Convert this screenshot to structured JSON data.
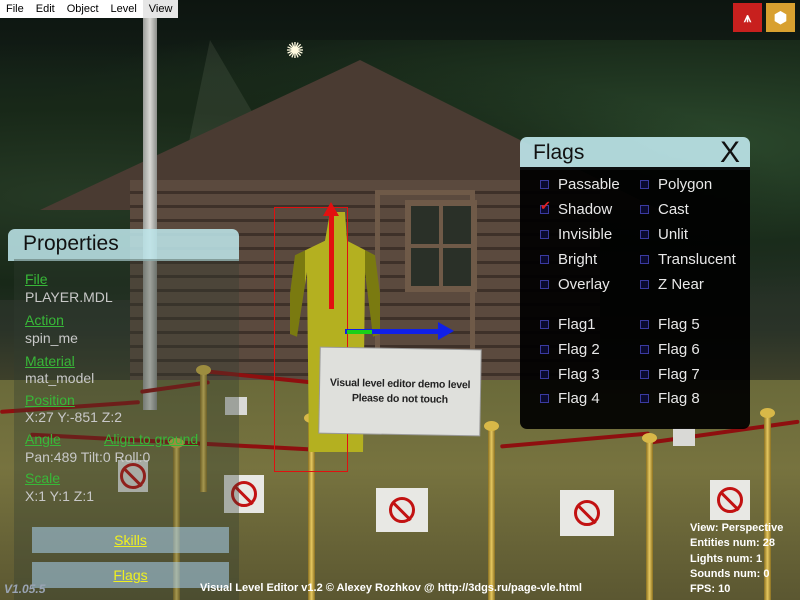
{
  "menu": {
    "items": [
      "File",
      "Edit",
      "Object",
      "Level",
      "View"
    ],
    "active": "View"
  },
  "toolbar": {
    "icons": [
      "atari-icon",
      "package-icon"
    ]
  },
  "scene": {
    "sign_lines": [
      "Visual level editor demo level",
      "Please do not touch"
    ]
  },
  "properties": {
    "title": "Properties",
    "file_label": "File",
    "file_value": "PLAYER.MDL",
    "action_label": "Action",
    "action_value": "spin_me",
    "material_label": "Material",
    "material_value": "mat_model",
    "position_label": "Position",
    "position_value": "X:27 Y:-851 Z:2",
    "angle_label": "Angle",
    "align_label": "Align to ground",
    "angle_value": "Pan:489 Tilt:0 Roll:0",
    "scale_label": "Scale",
    "scale_value": "X:1 Y:1 Z:1",
    "skills_button": "Skills",
    "flags_button": "Flags"
  },
  "flags": {
    "title": "Flags",
    "close": "X",
    "left": [
      {
        "label": "Passable",
        "checked": false
      },
      {
        "label": "Shadow",
        "checked": true
      },
      {
        "label": "Invisible",
        "checked": false
      },
      {
        "label": "Bright",
        "checked": false
      },
      {
        "label": "Overlay",
        "checked": false
      },
      {
        "label": "Flag1",
        "checked": false
      },
      {
        "label": "Flag 2",
        "checked": false
      },
      {
        "label": "Flag 3",
        "checked": false
      },
      {
        "label": "Flag 4",
        "checked": false
      }
    ],
    "right": [
      {
        "label": "Polygon",
        "checked": false
      },
      {
        "label": "Cast",
        "checked": false
      },
      {
        "label": "Unlit",
        "checked": false
      },
      {
        "label": "Translucent",
        "checked": false
      },
      {
        "label": "Z Near",
        "checked": false
      },
      {
        "label": "Flag 5",
        "checked": false
      },
      {
        "label": "Flag 6",
        "checked": false
      },
      {
        "label": "Flag 7",
        "checked": false
      },
      {
        "label": "Flag 8",
        "checked": false
      }
    ]
  },
  "status": {
    "view": "View: Perspective",
    "entities": "Entities num: 28",
    "lights": "Lights num: 1",
    "sounds": "Sounds num: 0",
    "fps": "FPS: 10"
  },
  "footer": {
    "credit": "Visual Level Editor v1.2 © Alexey Rozhkov @ http://3dgs.ru/page-vle.html",
    "version": "V1.05.5"
  }
}
